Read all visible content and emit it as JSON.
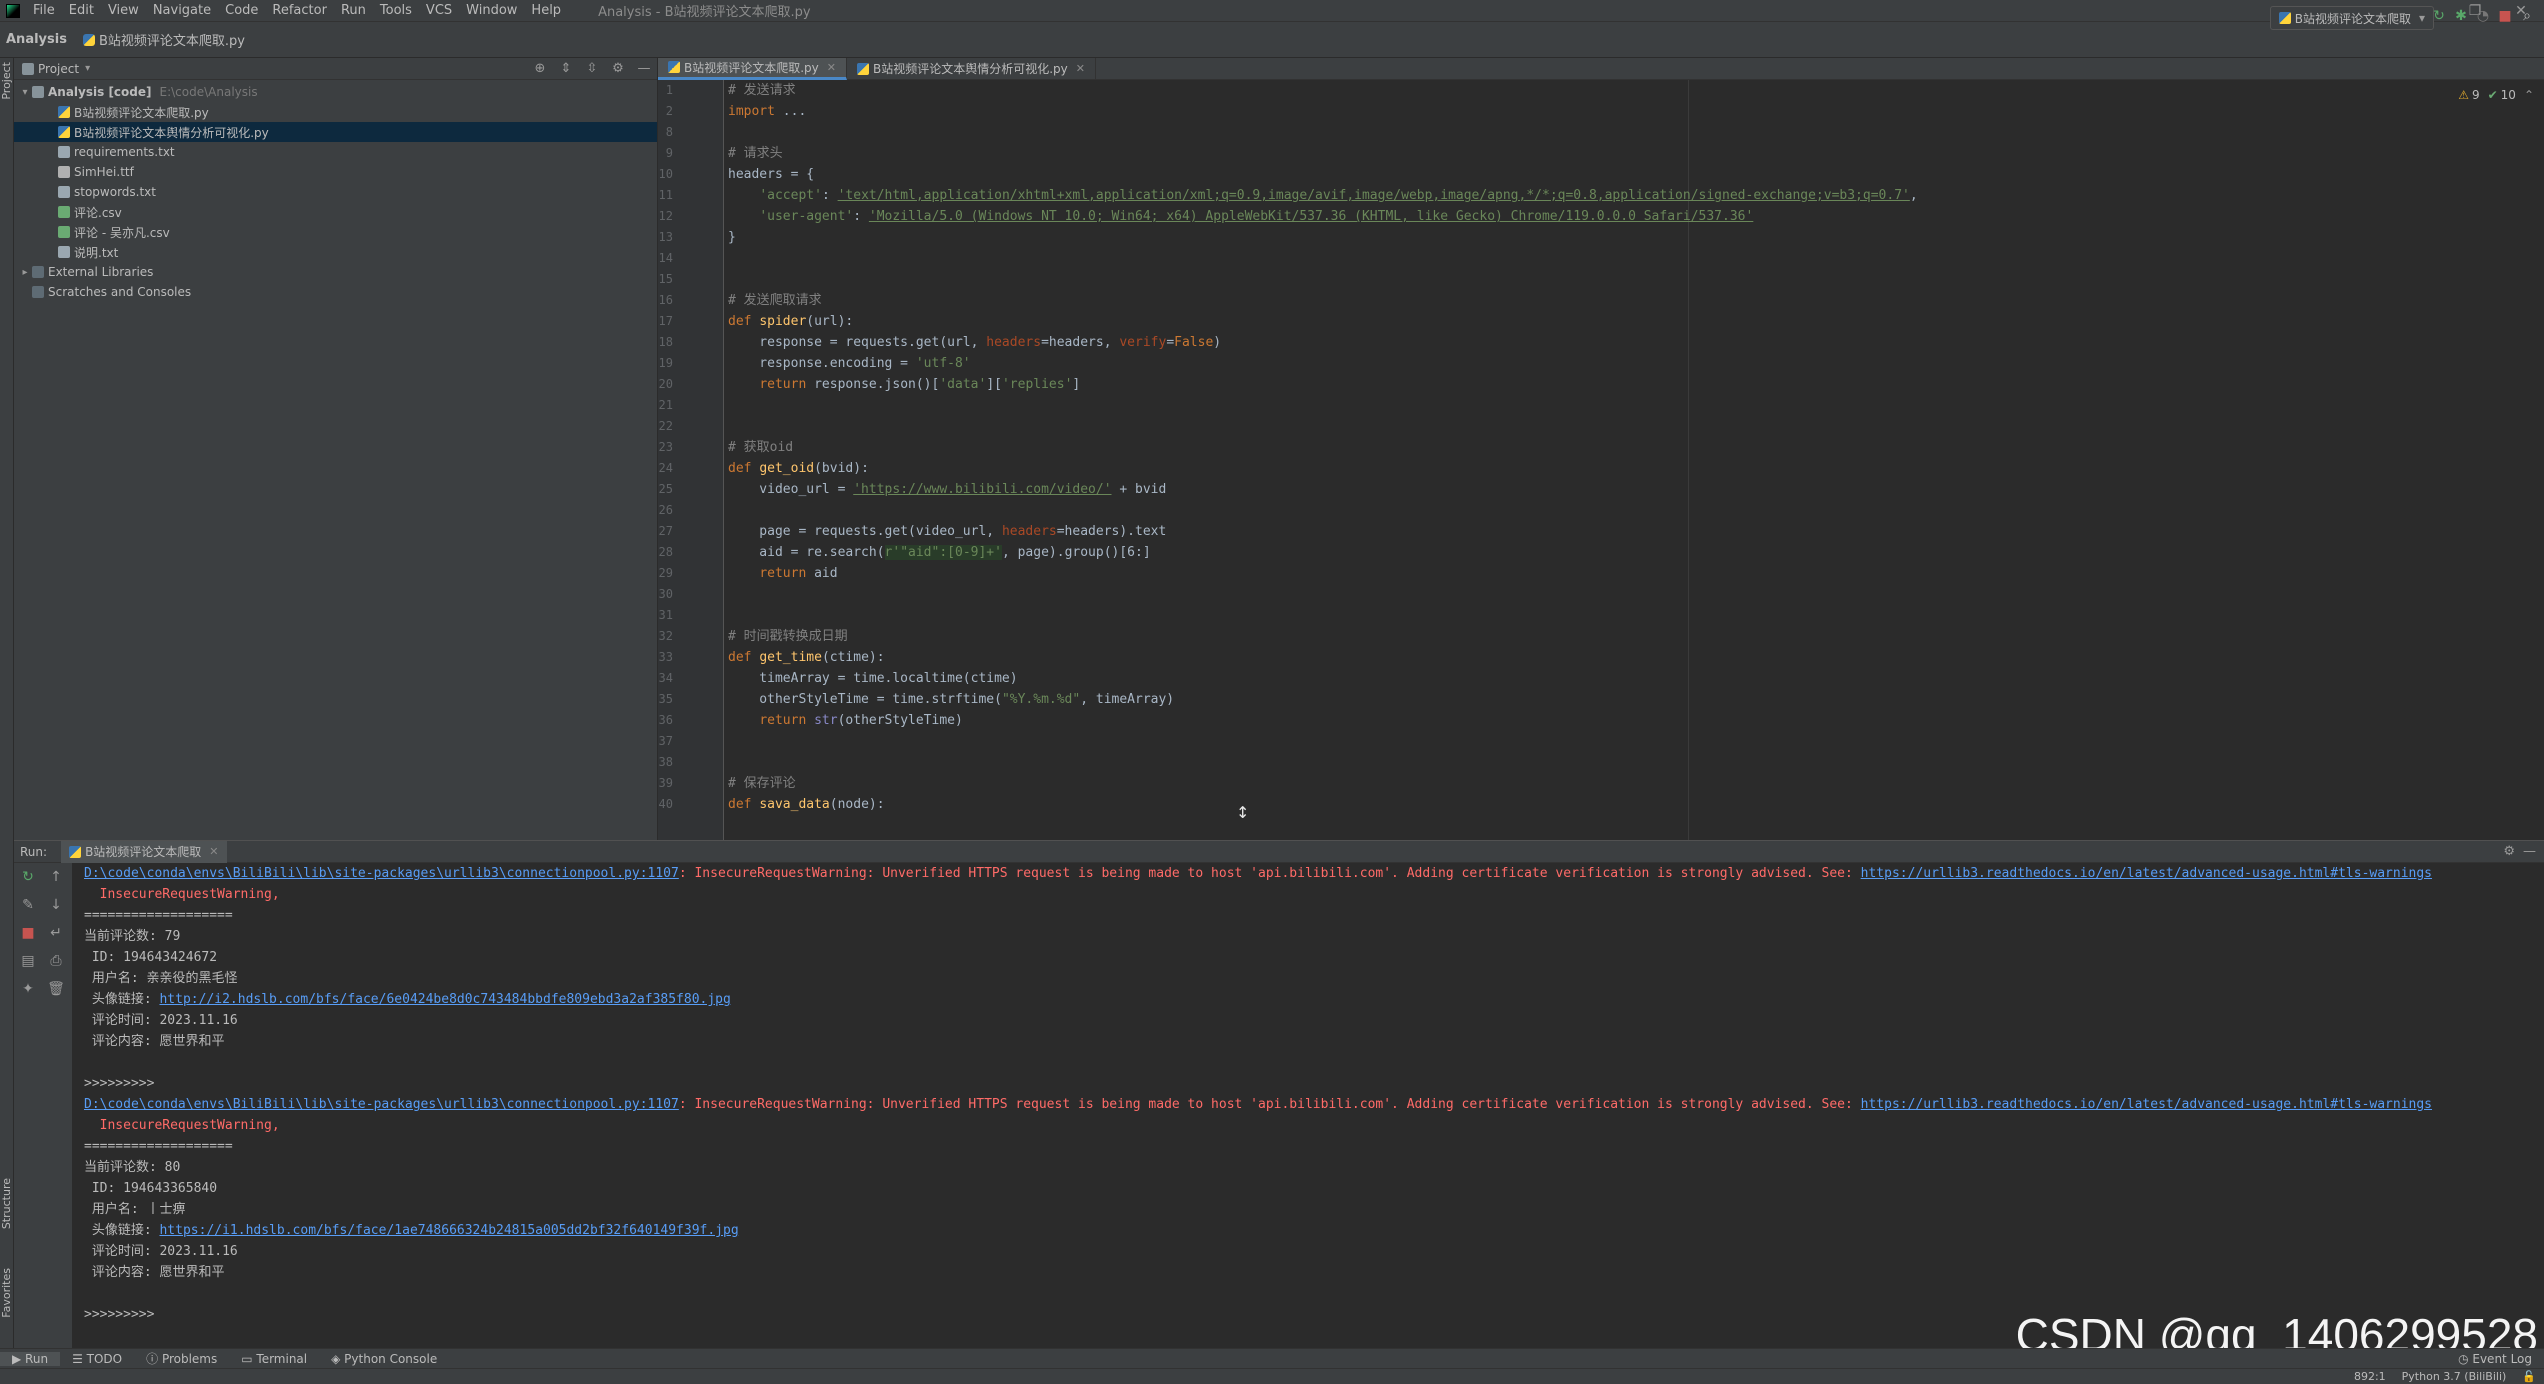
{
  "menubar": {
    "items": [
      "File",
      "Edit",
      "View",
      "Navigate",
      "Code",
      "Refactor",
      "Run",
      "Tools",
      "VCS",
      "Window",
      "Help"
    ],
    "title": "Analysis - B站视频评论文本爬取.py"
  },
  "navbar": {
    "project": "Analysis",
    "file": "B站视频评论文本爬取.py",
    "run_config": "B站视频评论文本爬取"
  },
  "sidebar": {
    "project_label": "Project",
    "structure_label": "Structure",
    "favorites_label": "Favorites",
    "vertical_project": "Project"
  },
  "project_tree": {
    "root": {
      "name": "Analysis [code]",
      "path": "E:\\code\\Analysis"
    },
    "files": [
      {
        "name": "B站视频评论文本爬取.py",
        "icon": "py"
      },
      {
        "name": "B站视频评论文本舆情分析可视化.py",
        "icon": "py"
      },
      {
        "name": "requirements.txt",
        "icon": "txt"
      },
      {
        "name": "SimHei.ttf",
        "icon": "ttf"
      },
      {
        "name": "stopwords.txt",
        "icon": "txt"
      },
      {
        "name": "评论.csv",
        "icon": "csv"
      },
      {
        "name": "评论 - 吴亦凡.csv",
        "icon": "csv"
      },
      {
        "name": "说明.txt",
        "icon": "txt"
      }
    ],
    "external": "External Libraries",
    "scratches": "Scratches and Consoles"
  },
  "editor": {
    "tabs": [
      {
        "label": "B站视频评论文本爬取.py",
        "active": true
      },
      {
        "label": "B站视频评论文本舆情分析可视化.py",
        "active": false
      }
    ],
    "inspections": {
      "warnings": "9",
      "ok": "10"
    },
    "line_numbers": [
      "1",
      "2",
      "8",
      "9",
      "10",
      "11",
      "12",
      "13",
      "14",
      "15",
      "16",
      "17",
      "18",
      "19",
      "20",
      "21",
      "22",
      "23",
      "24",
      "25",
      "26",
      "27",
      "28",
      "29",
      "30",
      "31",
      "32",
      "33",
      "34",
      "35",
      "36",
      "37",
      "38",
      "39",
      "40"
    ]
  },
  "code": {
    "l1": "# 发送请求",
    "l2_kw": "import",
    "l2_rest": " ...",
    "l9": "# 请求头",
    "l10": "headers = {",
    "l11_key": "'accept'",
    "l11_val": "'text/html,application/xhtml+xml,application/xml;q=0.9,image/avif,image/webp,image/apng,*/*;q=0.8,application/signed-exchange;v=b3;q=0.7'",
    "l12_key": "'user-agent'",
    "l12_val": "'Mozilla/5.0 (Windows NT 10.0; Win64; x64) AppleWebKit/537.36 (KHTML, like Gecko) Chrome/119.0.0.0 Safari/537.36'",
    "l13": "}",
    "l16": "# 发送爬取请求",
    "l17_def": "def",
    "l17_fn": "spider",
    "l17_rest": "(url):",
    "l18_a": "    response = requests.get(url, ",
    "l18_kw1": "headers",
    "l18_b": "=headers, ",
    "l18_kw2": "verify",
    "l18_c": "=",
    "l18_false": "False",
    "l18_d": ")",
    "l19_a": "    response.encoding = ",
    "l19_str": "'utf-8'",
    "l20_ret": "return",
    "l20_a": " response.json()[",
    "l20_s1": "'data'",
    "l20_b": "][",
    "l20_s2": "'replies'",
    "l20_c": "]",
    "l23": "# 获取oid",
    "l24_def": "def",
    "l24_fn": "get_oid",
    "l24_rest": "(bvid):",
    "l25_a": "    video_url = ",
    "l25_str": "'https://www.bilibili.com/video/'",
    "l25_b": " + bvid",
    "l27_a": "    page = requests.get(video_url, ",
    "l27_kw": "headers",
    "l27_b": "=headers).text",
    "l28_a": "    aid = re.search(",
    "l28_str": "r'\"aid\":[0-9]+'",
    "l28_b": ", page).group()[6:]",
    "l29_ret": "return",
    "l29_a": " aid",
    "l32": "# 时间戳转换成日期",
    "l33_def": "def",
    "l33_fn": "get_time",
    "l33_rest": "(ctime):",
    "l34": "    timeArray = time.localtime(ctime)",
    "l35_a": "    otherStyleTime = time.strftime(",
    "l35_str": "\"%Y.%m.%d\"",
    "l35_b": ", timeArray)",
    "l36_ret": "return",
    "l36_fn": " str",
    "l36_a": "(otherStyleTime)",
    "l39": "# 保存评论",
    "l40_def": "def",
    "l40_fn": "sava_data",
    "l40_rest": "(node):"
  },
  "run": {
    "label": "Run:",
    "tab": "B站视频评论文本爬取",
    "blocks": [
      {
        "warn_path": "D:\\code\\conda\\envs\\BiliBili\\lib\\site-packages\\urllib3\\connectionpool.py:1107",
        "warn_msg": ": InsecureRequestWarning: Unverified HTTPS request is being made to host 'api.bilibili.com'. Adding certificate verification is strongly advised. See: ",
        "warn_link": "https://urllib3.readthedocs.io/en/latest/advanced-usage.html#tls-warnings",
        "warn_tail": "  InsecureRequestWarning,",
        "sep": "===================",
        "count": "当前评论数: 79",
        "id": " ID: 194643424672",
        "user": " 用户名: 亲亲役的黑毛怪",
        "avatar_label": " 头像链接: ",
        "avatar_url": "http://i2.hdslb.com/bfs/face/6e0424be8d0c743484bbdfe809ebd3a2af385f80.jpg",
        "time": " 评论时间: 2023.11.16",
        "content": " 评论内容: 愿世界和平",
        "end": ">>>>>>>>>"
      },
      {
        "warn_path": "D:\\code\\conda\\envs\\BiliBili\\lib\\site-packages\\urllib3\\connectionpool.py:1107",
        "warn_msg": ": InsecureRequestWarning: Unverified HTTPS request is being made to host 'api.bilibili.com'. Adding certificate verification is strongly advised. See: ",
        "warn_link": "https://urllib3.readthedocs.io/en/latest/advanced-usage.html#tls-warnings",
        "warn_tail": "  InsecureRequestWarning,",
        "sep": "===================",
        "count": "当前评论数: 80",
        "id": " ID: 194643365840",
        "user": " 用户名: 丨士痹",
        "avatar_label": " 头像链接: ",
        "avatar_url": "https://i1.hdslb.com/bfs/face/1ae748666324b24815a005dd2bf32f640149f39f.jpg",
        "time": " 评论时间: 2023.11.16",
        "content": " 评论内容: 愿世界和平",
        "end": ">>>>>>>>>"
      }
    ]
  },
  "bottom_tools": [
    "Run",
    "TODO",
    "Problems",
    "Terminal",
    "Python Console"
  ],
  "status": {
    "event_log": "Event Log",
    "position": "892:1",
    "interpreter": "Python 3.7 (BiliBili)"
  },
  "watermark": "CSDN @qq_1406299528"
}
